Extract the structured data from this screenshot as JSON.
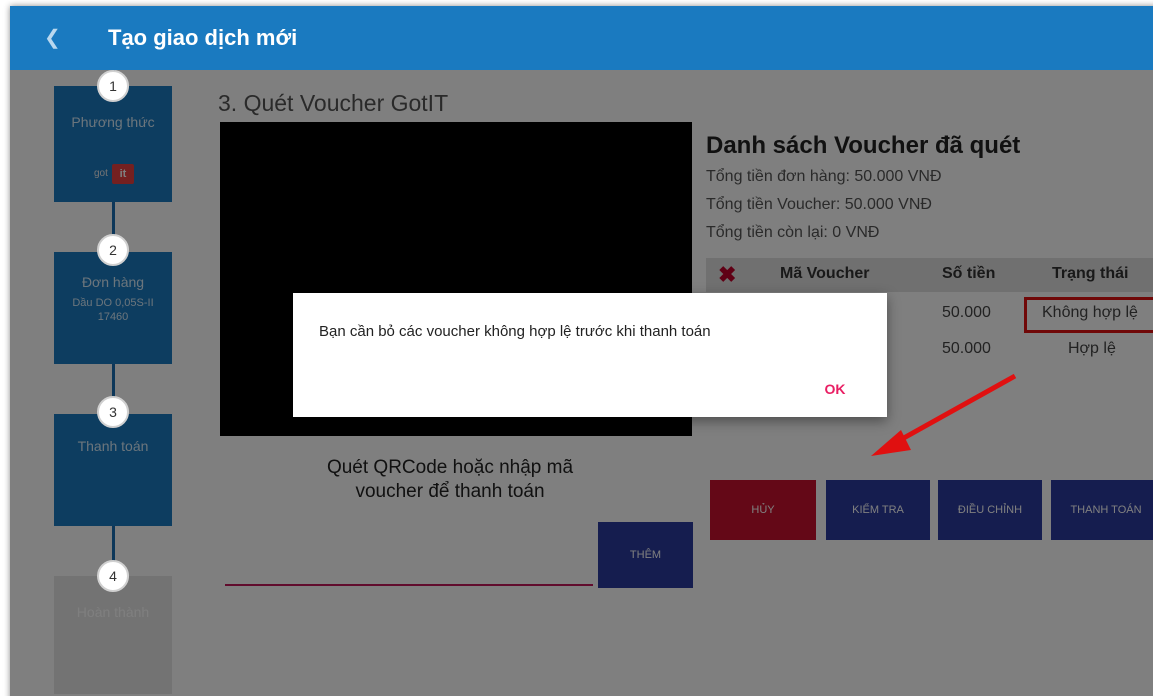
{
  "appbar": {
    "back_icon": "chevron-left-icon",
    "title": "Tạo giao dịch mới"
  },
  "stepper": {
    "steps": [
      {
        "number": "1",
        "label": "Phương thức",
        "logo_text_got": "got",
        "logo_text_it": "it"
      },
      {
        "number": "2",
        "label": "Đơn hàng",
        "sub1": "Dầu DO 0,05S-II",
        "sub2": "17460"
      },
      {
        "number": "3",
        "label": "Thanh toán"
      },
      {
        "number": "4",
        "label": "Hoàn thành"
      }
    ]
  },
  "scanner": {
    "title": "3. Quét Voucher GotIT",
    "hint_line1": "Quét QRCode hoặc nhập mã",
    "hint_line2": "voucher để thanh toán",
    "input_value": "",
    "add_button": "THÊM"
  },
  "voucher_list": {
    "title": "Danh sách Voucher đã quét",
    "order_total": "Tổng tiền đơn hàng: 50.000  VNĐ",
    "voucher_total": "Tổng tiền Voucher: 50.000  VNĐ",
    "remaining": "Tổng tiền còn lại: 0  VNĐ",
    "columns": {
      "code": "Mã Voucher",
      "amount": "Số tiền",
      "status": "Trạng thái"
    },
    "rows": [
      {
        "amount": "50.000",
        "status": "Không hợp lệ"
      },
      {
        "amount": "50.000",
        "status": "Hợp lệ"
      }
    ]
  },
  "actions": {
    "cancel": "HỦY",
    "check": "KIỂM TRA",
    "adjust": "ĐIỀU CHỈNH",
    "pay": "THANH TOÁN"
  },
  "dialog": {
    "message": "Bạn cần bỏ các voucher không hợp lệ trước khi thanh toán",
    "ok": "OK"
  },
  "colors": {
    "primary": "#1a7ac0",
    "button_blue": "#2a3a9e",
    "button_red": "#c8102e",
    "accent_pink": "#e91e63",
    "annotation_red": "#e01010"
  }
}
